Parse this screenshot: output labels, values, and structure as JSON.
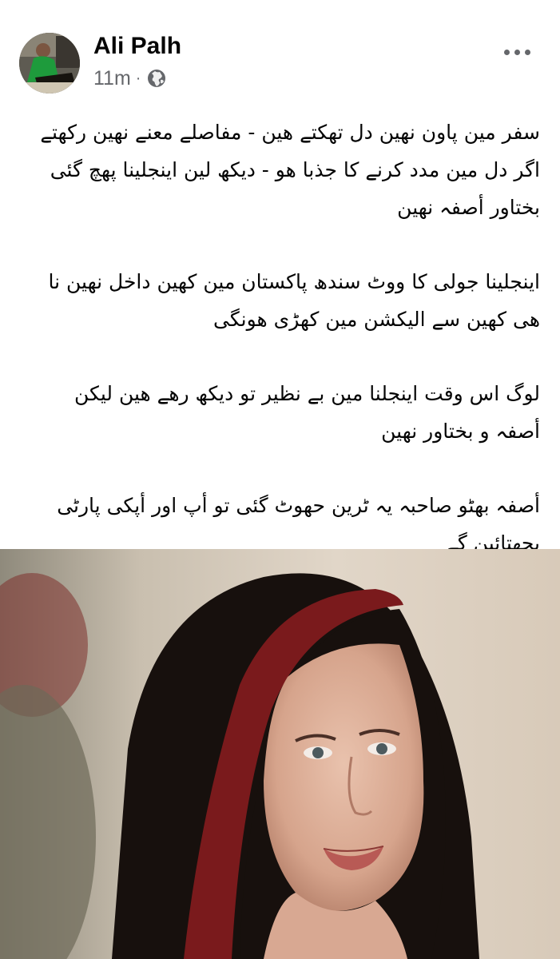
{
  "post": {
    "author_name": "Ali Palh",
    "timestamp": "11m",
    "separator": "·",
    "audience_icon": "globe-icon",
    "menu_icon": "more-horizontal-icon",
    "paragraphs": [
      "سفر مین پاون نهین دل تهکتے هین - مفاصلے معنے نهین رکهتے اگر دل مین مدد کرنے کا جذبا هو - دیکھ لین اینجلینا پهچ گئی بختاور أصفہ نهین",
      "اینجلینا جولی کا ووٹ سندھ پاکستان مین کهین داخل نهین نا هی کهین سے الیکشن مین کهڑی هونگی",
      "لوگ اس وقت اینجلنا مین بے نظیر تو دیکھ رهے هین لیکن أصفہ و بختاور نهین",
      "أصفہ بهٹو صاحبہ یہ ٹرین حهوٹ گئی تو أپ اور أپکی پارٹی پچهتائین گے"
    ]
  },
  "colors": {
    "text_primary": "#050505",
    "text_secondary": "#65676b",
    "scarf": "#17100d",
    "scarf_trim": "#7a1a1c"
  }
}
